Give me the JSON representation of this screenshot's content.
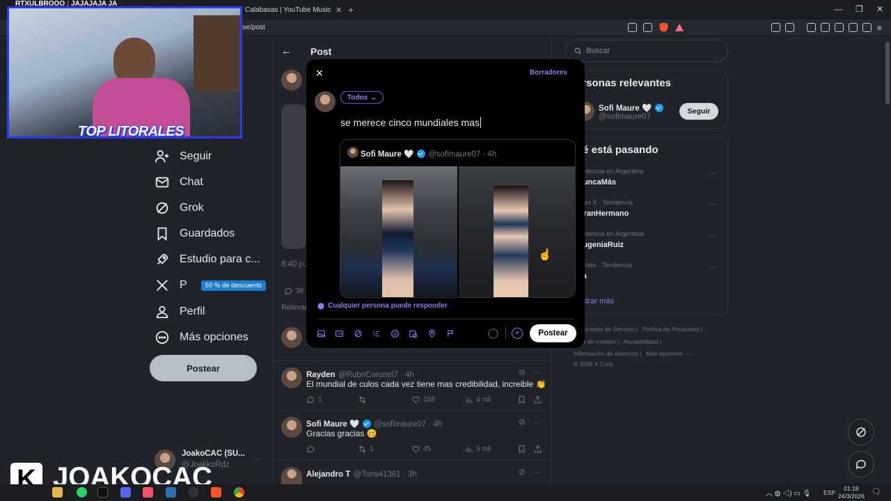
{
  "browser": {
    "tabs": [
      {
        "label": "Calabasas | YouTube Music"
      }
    ],
    "url": "ose/post",
    "stream_title": "RTXULBROOO : JAJAJAJA JA"
  },
  "nav": {
    "items": [
      {
        "label": "Seguir",
        "icon": "follow-icon"
      },
      {
        "label": "Chat",
        "icon": "mail-icon"
      },
      {
        "label": "Grok",
        "icon": "grok-icon"
      },
      {
        "label": "Guardados",
        "icon": "bookmark-icon"
      },
      {
        "label": "Estudio para c...",
        "icon": "rocket-icon"
      },
      {
        "label": "P",
        "icon": "x-premium-icon",
        "badge": "50 % de descuento"
      },
      {
        "label": "Perfil",
        "icon": "profile-icon"
      },
      {
        "label": "Más opciones",
        "icon": "more-icon"
      }
    ],
    "partial_label": "s",
    "post_button": "Postear",
    "account": {
      "name": "JoakoCAC (SU...",
      "handle": "@JoakkoRdz"
    }
  },
  "main": {
    "title": "Post",
    "timestamp_partial": "8:40 p.",
    "reply_count_partial": "38",
    "relevance_partial": "Relevan",
    "replies": [
      {
        "name": "Rayden",
        "handle": "@RubnCoronel7 · 4h",
        "verified": false,
        "text": "El mundial de culos cada vez tiene mas credibilidad, increible 👏",
        "reply": "1",
        "retweet": "",
        "like": "158",
        "views": "4 mil"
      },
      {
        "name": "Sofi Maure 🤍",
        "handle": "@sofimaure07 · 4h",
        "verified": true,
        "text": "Gracias gracias 🥴",
        "reply": "",
        "retweet": "1",
        "like": "45",
        "views": "3 mil"
      },
      {
        "name": "Alejandro T",
        "handle": "@Tomi41361 · 3h",
        "verified": false,
        "text": ""
      }
    ]
  },
  "modal": {
    "drafts": "Borradores",
    "audience": "Todos",
    "compose_text": "se merece cinco mundiales mas",
    "quote": {
      "name": "Sofi Maure 🤍",
      "handle": "@sofimaure07 · 4h"
    },
    "reply_setting": "Cualquier persona puede responder",
    "post_button": "Postear",
    "tools": [
      "image-icon",
      "gif-icon",
      "grok-icon",
      "poll-icon",
      "emoji-icon",
      "schedule-icon",
      "location-icon",
      "flag-icon"
    ]
  },
  "right": {
    "search_placeholder": "Buscar",
    "relevant": {
      "title": "ersonas relevantes",
      "person": {
        "name": "Sofi Maure 🤍",
        "handle": "@sofimaure07",
        "button": "Seguir"
      }
    },
    "trends": {
      "title": "ué está pasando",
      "items": [
        {
          "context": "endencia en Argentina",
          "name": "NuncaMás"
        },
        {
          "context": "o en X · Tendencia",
          "name": "GranHermano"
        },
        {
          "context": "endencia en Argentina",
          "name": "EugeniaRuiz"
        },
        {
          "context": "portes · Tendencia",
          "name": "pa"
        }
      ],
      "show_more": "ostrar más"
    },
    "footer": {
      "line1": [
        "ondiciones de Servicio",
        "Política de Privacidad"
      ],
      "line2": [
        "ítica de cookies",
        "Accesibilidad"
      ],
      "line3": [
        "Información de anuncios",
        "Más opciones ···"
      ],
      "copyright": "© 2026 X Corp."
    }
  },
  "overlay": {
    "brand_logo": "TOP LITORALES",
    "streamer_letter": "K",
    "streamer_name": "JOAKOCAC"
  },
  "taskbar": {
    "lang": "ESP",
    "time": "01:18",
    "date": "24/3/2026"
  }
}
